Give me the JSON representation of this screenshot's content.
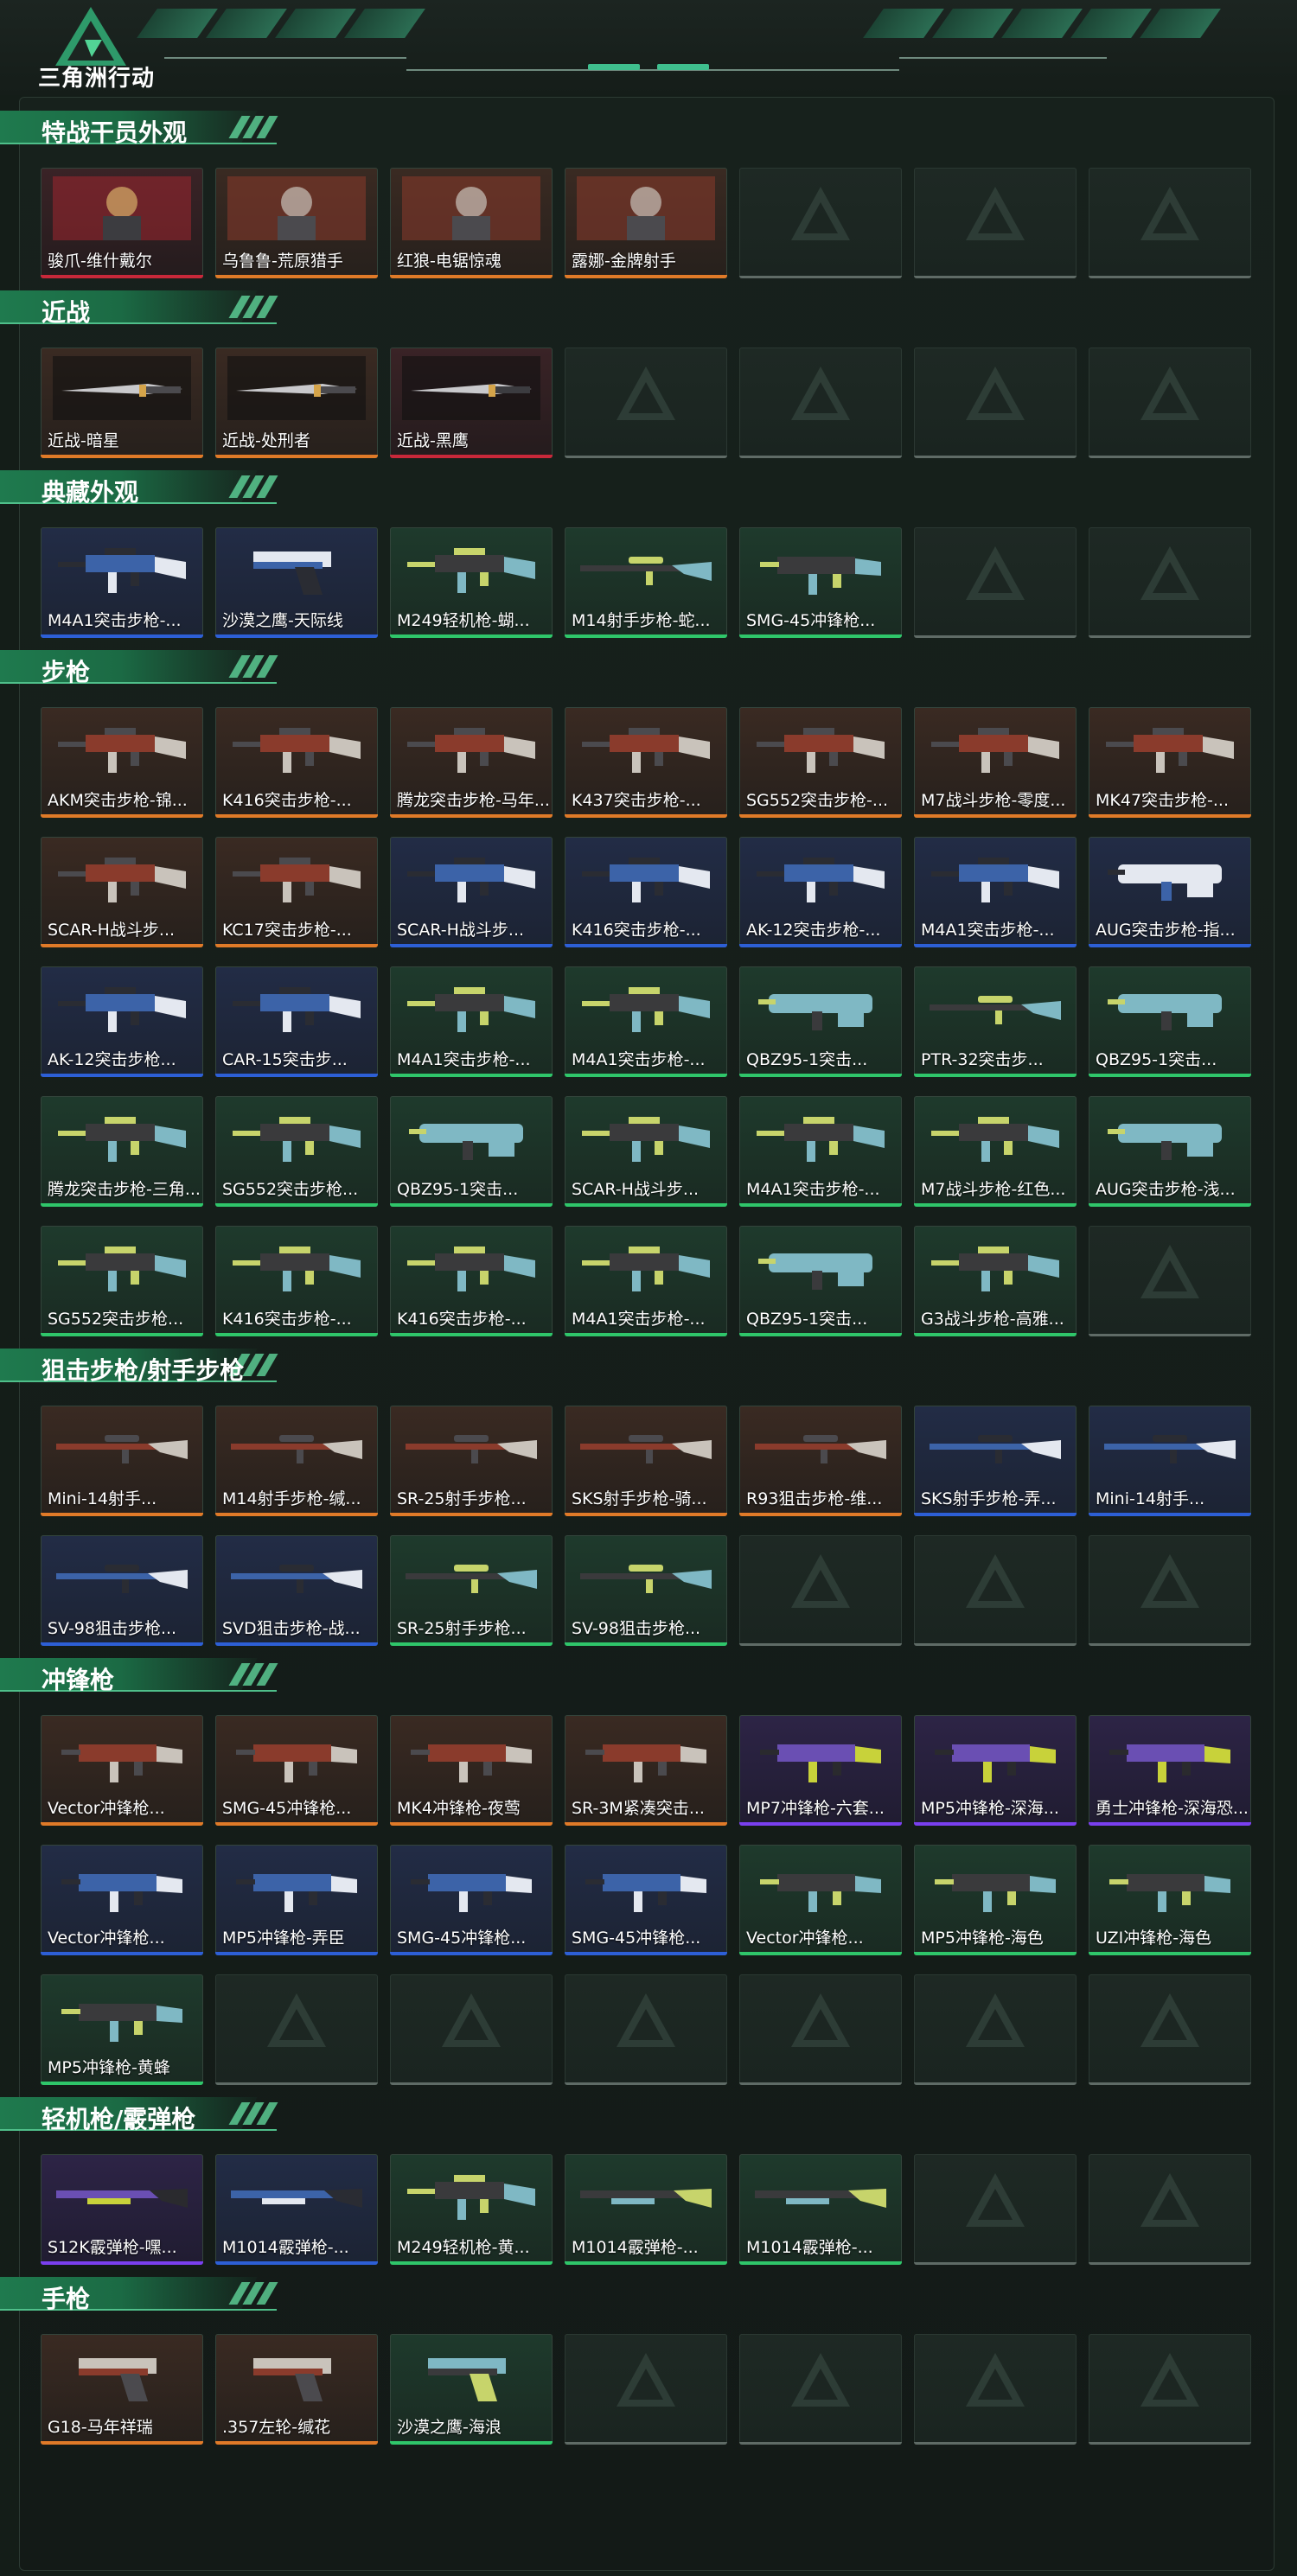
{
  "brand": {
    "name": "三角洲行动"
  },
  "colors": {
    "orange": "#e07a28",
    "red": "#c8283a",
    "blue": "#2d5fd6",
    "purple": "#7a3ff0",
    "green": "#2fc66a",
    "empty": "#5f6b66"
  },
  "sections": [
    {
      "title": "特战干员外观",
      "items": [
        {
          "label": "骏爪-维什戴尔",
          "rarity": "red",
          "kind": "portrait"
        },
        {
          "label": "乌鲁鲁-荒原猎手",
          "rarity": "orange",
          "kind": "portrait"
        },
        {
          "label": "红狼-电锯惊魂",
          "rarity": "orange",
          "kind": "portrait"
        },
        {
          "label": "露娜-金牌射手",
          "rarity": "orange",
          "kind": "portrait"
        },
        {
          "label": "",
          "rarity": "empty"
        },
        {
          "label": "",
          "rarity": "empty"
        },
        {
          "label": "",
          "rarity": "empty"
        }
      ]
    },
    {
      "title": "近战",
      "items": [
        {
          "label": "近战-暗星",
          "rarity": "orange",
          "kind": "knife"
        },
        {
          "label": "近战-处刑者",
          "rarity": "orange",
          "kind": "knife"
        },
        {
          "label": "近战-黑鹰",
          "rarity": "red",
          "kind": "knife"
        },
        {
          "label": "",
          "rarity": "empty"
        },
        {
          "label": "",
          "rarity": "empty"
        },
        {
          "label": "",
          "rarity": "empty"
        },
        {
          "label": "",
          "rarity": "empty"
        }
      ]
    },
    {
      "title": "典藏外观",
      "items": [
        {
          "label": "M4A1突击步枪-...",
          "rarity": "blue",
          "kind": "rifle"
        },
        {
          "label": "沙漠之鹰-天际线",
          "rarity": "blue",
          "kind": "pistol"
        },
        {
          "label": "M249轻机枪-蝴...",
          "rarity": "green",
          "kind": "rifle"
        },
        {
          "label": "M14射手步枪-蛇...",
          "rarity": "green",
          "kind": "sniper"
        },
        {
          "label": "SMG-45冲锋枪...",
          "rarity": "green",
          "kind": "smg"
        },
        {
          "label": "",
          "rarity": "empty"
        },
        {
          "label": "",
          "rarity": "empty"
        }
      ]
    },
    {
      "title": "步枪",
      "items": [
        {
          "label": "AKM突击步枪-锦...",
          "rarity": "orange",
          "kind": "rifle"
        },
        {
          "label": "K416突击步枪-...",
          "rarity": "orange",
          "kind": "rifle"
        },
        {
          "label": "腾龙突击步枪-马年...",
          "rarity": "orange",
          "kind": "rifle"
        },
        {
          "label": "K437突击步枪-...",
          "rarity": "orange",
          "kind": "rifle"
        },
        {
          "label": "SG552突击步枪-...",
          "rarity": "orange",
          "kind": "rifle"
        },
        {
          "label": "M7战斗步枪-零度...",
          "rarity": "orange",
          "kind": "rifle"
        },
        {
          "label": "MK47突击步枪-...",
          "rarity": "orange",
          "kind": "rifle"
        },
        {
          "label": "SCAR-H战斗步...",
          "rarity": "orange",
          "kind": "rifle"
        },
        {
          "label": "KC17突击步枪-...",
          "rarity": "orange",
          "kind": "rifle"
        },
        {
          "label": "SCAR-H战斗步...",
          "rarity": "blue",
          "kind": "rifle"
        },
        {
          "label": "K416突击步枪-...",
          "rarity": "blue",
          "kind": "rifle"
        },
        {
          "label": "AK-12突击步枪-...",
          "rarity": "blue",
          "kind": "rifle"
        },
        {
          "label": "M4A1突击步枪-...",
          "rarity": "blue",
          "kind": "rifle"
        },
        {
          "label": "AUG突击步枪-指...",
          "rarity": "blue",
          "kind": "bullpup"
        },
        {
          "label": "AK-12突击步枪...",
          "rarity": "blue",
          "kind": "rifle"
        },
        {
          "label": "CAR-15突击步...",
          "rarity": "blue",
          "kind": "rifle"
        },
        {
          "label": "M4A1突击步枪-...",
          "rarity": "green",
          "kind": "rifle"
        },
        {
          "label": "M4A1突击步枪-...",
          "rarity": "green",
          "kind": "rifle"
        },
        {
          "label": "QBZ95-1突击...",
          "rarity": "green",
          "kind": "bullpup"
        },
        {
          "label": "PTR-32突击步...",
          "rarity": "green",
          "kind": "sniper"
        },
        {
          "label": "QBZ95-1突击...",
          "rarity": "green",
          "kind": "bullpup"
        },
        {
          "label": "腾龙突击步枪-三角...",
          "rarity": "green",
          "kind": "rifle"
        },
        {
          "label": "SG552突击步枪...",
          "rarity": "green",
          "kind": "rifle"
        },
        {
          "label": "QBZ95-1突击...",
          "rarity": "green",
          "kind": "bullpup"
        },
        {
          "label": "SCAR-H战斗步...",
          "rarity": "green",
          "kind": "rifle"
        },
        {
          "label": "M4A1突击步枪-...",
          "rarity": "green",
          "kind": "rifle"
        },
        {
          "label": "M7战斗步枪-红色...",
          "rarity": "green",
          "kind": "rifle"
        },
        {
          "label": "AUG突击步枪-浅...",
          "rarity": "green",
          "kind": "bullpup"
        },
        {
          "label": "SG552突击步枪...",
          "rarity": "green",
          "kind": "rifle"
        },
        {
          "label": "K416突击步枪-...",
          "rarity": "green",
          "kind": "rifle"
        },
        {
          "label": "K416突击步枪-...",
          "rarity": "green",
          "kind": "rifle"
        },
        {
          "label": "M4A1突击步枪-...",
          "rarity": "green",
          "kind": "rifle"
        },
        {
          "label": "QBZ95-1突击...",
          "rarity": "green",
          "kind": "bullpup"
        },
        {
          "label": "G3战斗步枪-高雅...",
          "rarity": "green",
          "kind": "rifle"
        },
        {
          "label": "",
          "rarity": "empty"
        }
      ]
    },
    {
      "title": "狙击步枪/射手步枪",
      "items": [
        {
          "label": "Mini-14射手...",
          "rarity": "orange",
          "kind": "sniper"
        },
        {
          "label": "M14射手步枪-缄...",
          "rarity": "orange",
          "kind": "sniper"
        },
        {
          "label": "SR-25射手步枪...",
          "rarity": "orange",
          "kind": "sniper"
        },
        {
          "label": "SKS射手步枪-骑...",
          "rarity": "orange",
          "kind": "sniper"
        },
        {
          "label": "R93狙击步枪-维...",
          "rarity": "orange",
          "kind": "sniper"
        },
        {
          "label": "SKS射手步枪-弄...",
          "rarity": "blue",
          "kind": "sniper"
        },
        {
          "label": "Mini-14射手...",
          "rarity": "blue",
          "kind": "sniper"
        },
        {
          "label": "SV-98狙击步枪...",
          "rarity": "blue",
          "kind": "sniper"
        },
        {
          "label": "SVD狙击步枪-战...",
          "rarity": "blue",
          "kind": "sniper"
        },
        {
          "label": "SR-25射手步枪...",
          "rarity": "green",
          "kind": "sniper"
        },
        {
          "label": "SV-98狙击步枪...",
          "rarity": "green",
          "kind": "sniper"
        },
        {
          "label": "",
          "rarity": "empty"
        },
        {
          "label": "",
          "rarity": "empty"
        },
        {
          "label": "",
          "rarity": "empty"
        }
      ]
    },
    {
      "title": "冲锋枪",
      "items": [
        {
          "label": "Vector冲锋枪...",
          "rarity": "orange",
          "kind": "smg"
        },
        {
          "label": "SMG-45冲锋枪...",
          "rarity": "orange",
          "kind": "smg"
        },
        {
          "label": "MK4冲锋枪-夜莺",
          "rarity": "orange",
          "kind": "smg"
        },
        {
          "label": "SR-3M紧凑突击...",
          "rarity": "orange",
          "kind": "smg"
        },
        {
          "label": "MP7冲锋枪-六套...",
          "rarity": "purple",
          "kind": "smg"
        },
        {
          "label": "MP5冲锋枪-深海...",
          "rarity": "purple",
          "kind": "smg"
        },
        {
          "label": "勇士冲锋枪-深海恐...",
          "rarity": "purple",
          "kind": "smg"
        },
        {
          "label": "Vector冲锋枪...",
          "rarity": "blue",
          "kind": "smg"
        },
        {
          "label": "MP5冲锋枪-弄臣",
          "rarity": "blue",
          "kind": "smg"
        },
        {
          "label": "SMG-45冲锋枪...",
          "rarity": "blue",
          "kind": "smg"
        },
        {
          "label": "SMG-45冲锋枪...",
          "rarity": "blue",
          "kind": "smg"
        },
        {
          "label": "Vector冲锋枪...",
          "rarity": "green",
          "kind": "smg"
        },
        {
          "label": "MP5冲锋枪-海色",
          "rarity": "green",
          "kind": "smg"
        },
        {
          "label": "UZI冲锋枪-海色",
          "rarity": "green",
          "kind": "smg"
        },
        {
          "label": "MP5冲锋枪-黄蜂",
          "rarity": "green",
          "kind": "smg"
        },
        {
          "label": "",
          "rarity": "empty"
        },
        {
          "label": "",
          "rarity": "empty"
        },
        {
          "label": "",
          "rarity": "empty"
        },
        {
          "label": "",
          "rarity": "empty"
        },
        {
          "label": "",
          "rarity": "empty"
        },
        {
          "label": "",
          "rarity": "empty"
        }
      ]
    },
    {
      "title": "轻机枪/霰弹枪",
      "items": [
        {
          "label": "S12K霰弹枪-嘿...",
          "rarity": "purple",
          "kind": "shotgun"
        },
        {
          "label": "M1014霰弹枪-...",
          "rarity": "blue",
          "kind": "shotgun"
        },
        {
          "label": "M249轻机枪-黄...",
          "rarity": "green",
          "kind": "rifle"
        },
        {
          "label": "M1014霰弹枪-...",
          "rarity": "green",
          "kind": "shotgun"
        },
        {
          "label": "M1014霰弹枪-...",
          "rarity": "green",
          "kind": "shotgun"
        },
        {
          "label": "",
          "rarity": "empty"
        },
        {
          "label": "",
          "rarity": "empty"
        }
      ]
    },
    {
      "title": "手枪",
      "items": [
        {
          "label": "G18-马年祥瑞",
          "rarity": "orange",
          "kind": "pistol"
        },
        {
          "label": ".357左轮-缄花",
          "rarity": "orange",
          "kind": "pistol"
        },
        {
          "label": "沙漠之鹰-海浪",
          "rarity": "green",
          "kind": "pistol"
        },
        {
          "label": "",
          "rarity": "empty"
        },
        {
          "label": "",
          "rarity": "empty"
        },
        {
          "label": "",
          "rarity": "empty"
        },
        {
          "label": "",
          "rarity": "empty"
        }
      ]
    }
  ]
}
